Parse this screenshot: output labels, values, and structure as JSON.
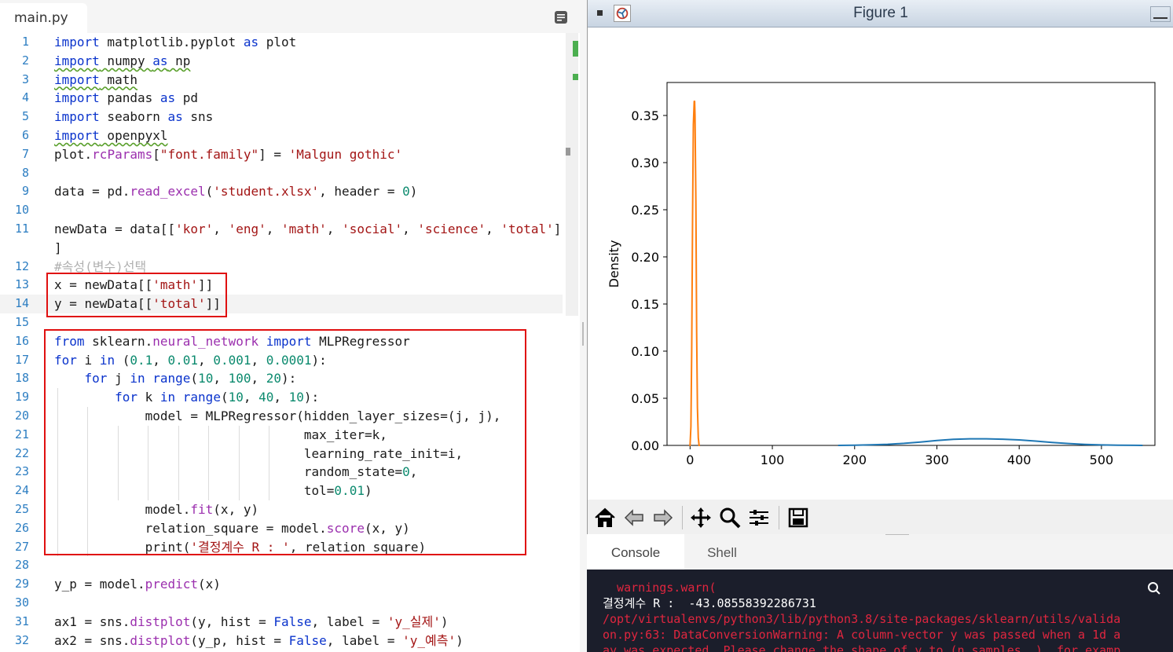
{
  "editor": {
    "file_tab": "main.py",
    "lines": [
      {
        "n": "1",
        "t": "import matplotlib.pyplot as plot"
      },
      {
        "n": "2",
        "t": "import numpy as np"
      },
      {
        "n": "3",
        "t": "import math"
      },
      {
        "n": "4",
        "t": "import pandas as pd"
      },
      {
        "n": "5",
        "t": "import seaborn as sns"
      },
      {
        "n": "6",
        "t": "import openpyxl"
      },
      {
        "n": "7",
        "t": "plot.rcParams[\"font.family\"] = 'Malgun gothic'"
      },
      {
        "n": "8",
        "t": ""
      },
      {
        "n": "9",
        "t": "data = pd.read_excel('student.xlsx', header = 0)"
      },
      {
        "n": "10",
        "t": ""
      },
      {
        "n": "11",
        "t": "newData = data[['kor', 'eng', 'math', 'social', 'science', 'total']"
      },
      {
        "n": "",
        "t": "]"
      },
      {
        "n": "12",
        "t": "#속성(변수)선택"
      },
      {
        "n": "13",
        "t": "x = newData[['math']]"
      },
      {
        "n": "14",
        "t": "y = newData[['total']]"
      },
      {
        "n": "15",
        "t": ""
      },
      {
        "n": "16",
        "t": "from sklearn.neural_network import MLPRegressor"
      },
      {
        "n": "17",
        "t": "for i in (0.1, 0.01, 0.001, 0.0001):"
      },
      {
        "n": "18",
        "t": "    for j in range(10, 100, 20):"
      },
      {
        "n": "19",
        "t": "        for k in range(10, 40, 10):"
      },
      {
        "n": "20",
        "t": "            model = MLPRegressor(hidden_layer_sizes=(j, j),"
      },
      {
        "n": "21",
        "t": "                                 max_iter=k,"
      },
      {
        "n": "22",
        "t": "                                 learning_rate_init=i,"
      },
      {
        "n": "23",
        "t": "                                 random_state=0,"
      },
      {
        "n": "24",
        "t": "                                 tol=0.01)"
      },
      {
        "n": "25",
        "t": "            model.fit(x, y)"
      },
      {
        "n": "26",
        "t": "            relation_square = model.score(x, y)"
      },
      {
        "n": "27",
        "t": "            print('결정계수 R : ', relation_square)"
      },
      {
        "n": "28",
        "t": ""
      },
      {
        "n": "29",
        "t": "y_p = model.predict(x)"
      },
      {
        "n": "30",
        "t": ""
      },
      {
        "n": "31",
        "t": "ax1 = sns.distplot(y, hist = False, label = 'y_실제')"
      },
      {
        "n": "32",
        "t": "ax2 = sns.distplot(y_p, hist = False, label = 'y_예측')"
      }
    ]
  },
  "figure": {
    "window_title": "Figure 1",
    "toolbar": [
      "home-icon",
      "back-icon",
      "forward-icon",
      "pan-icon",
      "zoom-icon",
      "configure-subplots-icon",
      "save-icon"
    ]
  },
  "chart_data": {
    "type": "line",
    "title": "",
    "xlabel": "",
    "ylabel": "Density",
    "xlim": [
      -28,
      565
    ],
    "ylim": [
      0,
      0.385
    ],
    "xticks": [
      "0",
      "100",
      "200",
      "300",
      "400",
      "500"
    ],
    "yticks": [
      "0.00",
      "0.05",
      "0.10",
      "0.15",
      "0.20",
      "0.25",
      "0.30",
      "0.35"
    ],
    "grid": false,
    "legend": "none",
    "series": [
      {
        "color": "#1f77b4",
        "x": [
          180,
          200,
          220,
          240,
          260,
          280,
          300,
          320,
          340,
          360,
          380,
          400,
          420,
          440,
          460,
          480,
          500,
          520,
          540,
          550
        ],
        "y": [
          0.0,
          0.0002,
          0.0006,
          0.0012,
          0.0022,
          0.0036,
          0.0052,
          0.0064,
          0.007,
          0.007,
          0.0066,
          0.0058,
          0.0046,
          0.0032,
          0.002,
          0.0011,
          0.0005,
          0.0002,
          0.0001,
          0.0
        ]
      },
      {
        "color": "#ff7f0e",
        "x": [
          -1,
          0,
          1,
          2,
          3,
          4,
          5,
          5.5,
          6,
          7,
          8,
          9,
          10,
          11,
          12
        ],
        "y": [
          0.0,
          0.0,
          0.02,
          0.1,
          0.24,
          0.34,
          0.365,
          0.365,
          0.35,
          0.26,
          0.12,
          0.04,
          0.008,
          0.0,
          0.0
        ]
      }
    ]
  },
  "console": {
    "tabs": [
      "Console",
      "Shell"
    ],
    "lines": [
      {
        "cls": "warn",
        "t": "  warnings.warn("
      },
      {
        "cls": "out",
        "t": "결정계수 R :  -43.08558392286731"
      },
      {
        "cls": "warn",
        "t": "/opt/virtualenvs/python3/lib/python3.8/site-packages/sklearn/utils/valida"
      },
      {
        "cls": "warn",
        "t": "on.py:63: DataConversionWarning: A column-vector y was passed when a 1d a"
      },
      {
        "cls": "warn",
        "t": "ay was expected. Please change the shape of y to (n_samples, ), for examp"
      }
    ]
  }
}
